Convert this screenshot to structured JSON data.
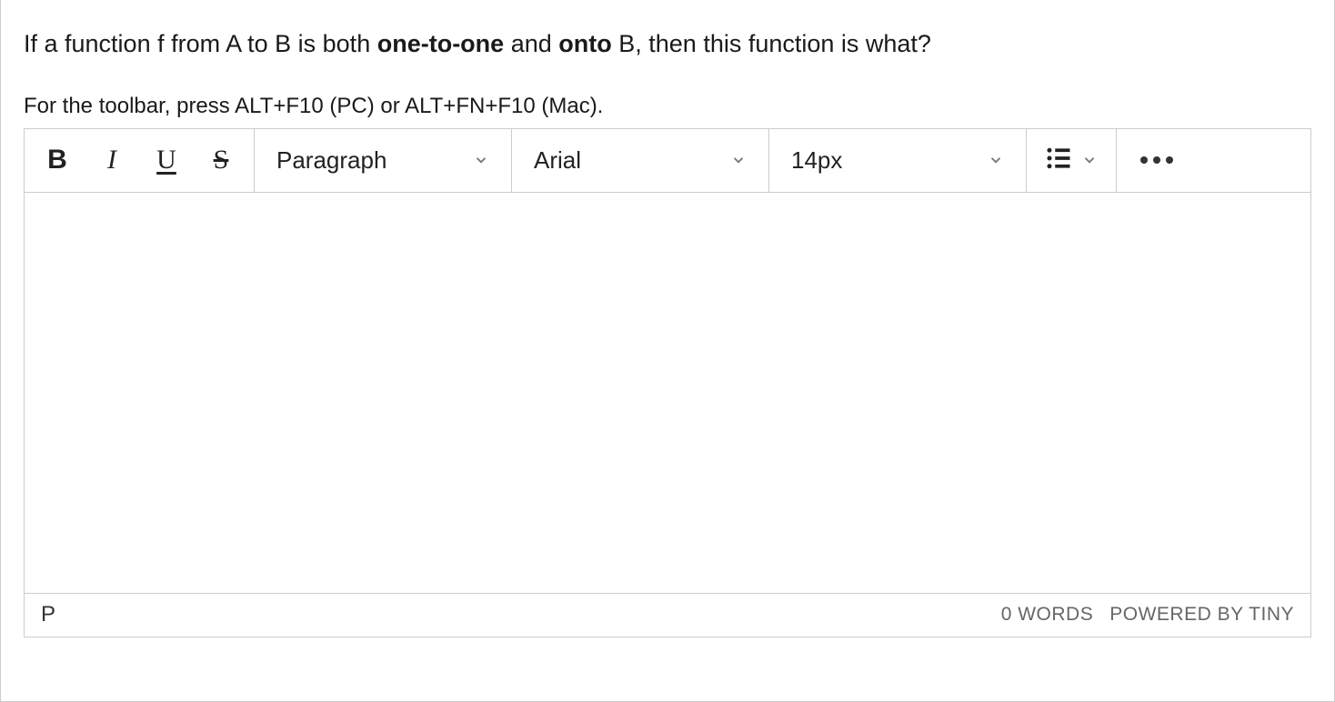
{
  "question": {
    "prefix": "If a function f from A to B is both ",
    "bold1": "one-to-one",
    "mid": " and ",
    "bold2": "onto",
    "suffix": " B, then this function is what?"
  },
  "hint": "For the toolbar, press ALT+F10 (PC) or ALT+FN+F10 (Mac).",
  "toolbar": {
    "bold": "B",
    "italic": "I",
    "underline": "U",
    "strike": "S",
    "format": "Paragraph",
    "font": "Arial",
    "size": "14px"
  },
  "statusbar": {
    "path": "P",
    "words": "0 WORDS",
    "powered": "POWERED BY TINY"
  }
}
